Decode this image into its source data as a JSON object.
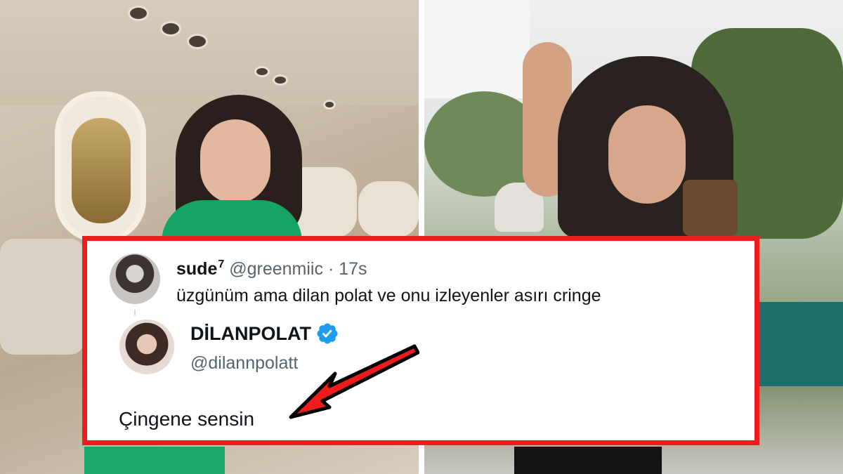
{
  "tweet": {
    "author": {
      "display_name": "sude",
      "superscript": "7",
      "handle": "@greenmiic",
      "separator": "·",
      "time": "17s"
    },
    "text": "üzgünüm ama dilan polat ve onu izleyenler asırı cringe"
  },
  "reply": {
    "author": {
      "display_name": "DİLANPOLAT",
      "handle": "@dilannpolatt",
      "verified": true
    },
    "text": "Çingene sensin"
  },
  "colors": {
    "highlight_border": "#ee1c1c",
    "verified_badge": "#1d9bf0",
    "arrow": "#ee1c1c"
  },
  "icons": {
    "verified": "verified-badge-icon",
    "arrow": "red-arrow-icon"
  }
}
